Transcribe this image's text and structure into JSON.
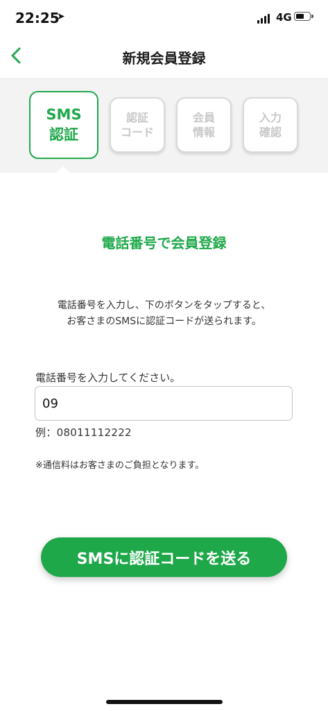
{
  "status_bar": {
    "time": "22:25",
    "location_icon": "location-arrow-icon",
    "network": "4G"
  },
  "nav": {
    "back_icon": "chevron-left-icon",
    "title": "新規会員登録"
  },
  "steps": [
    {
      "line1": "SMS",
      "line2": "認証",
      "active": true
    },
    {
      "line1": "認証",
      "line2": "コード",
      "active": false
    },
    {
      "line1": "会員",
      "line2": "情報",
      "active": false
    },
    {
      "line1": "入力",
      "line2": "確認",
      "active": false
    }
  ],
  "main": {
    "heading": "電話番号で会員登録",
    "description_line1": "電話番号を入力し、下のボタンをタップすると、",
    "description_line2": "お客さまのSMSに認証コードが送られます。",
    "field_label": "電話番号を入力してください。",
    "phone_value": "09",
    "example": "例：08011112222",
    "note": "※通信料はお客さまのご負担となります。",
    "send_button": "SMSに認証コードを送る"
  },
  "colors": {
    "accent": "#1fa84a",
    "step_band": "#f3f3f3",
    "inactive_text": "#c8c8c8"
  }
}
